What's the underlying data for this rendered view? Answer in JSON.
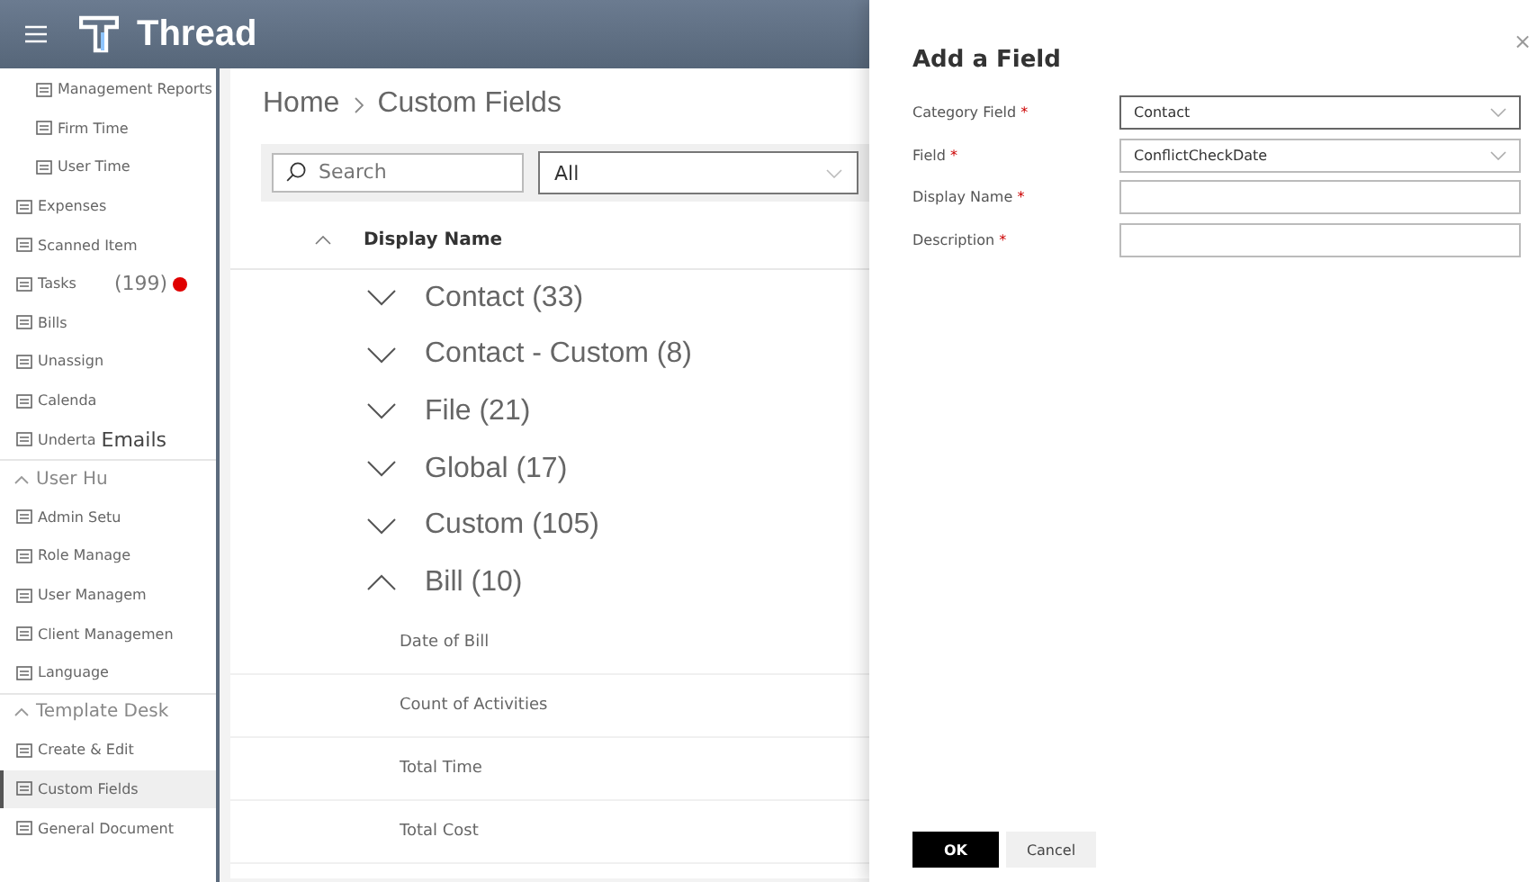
{
  "header": {
    "title": "Thread"
  },
  "sidebar": {
    "items": [
      {
        "kind": "subitem",
        "label": "Management Reports",
        "selected": false
      },
      {
        "kind": "subitem",
        "label": "Firm Time",
        "selected": false
      },
      {
        "kind": "subitem",
        "label": "User Time",
        "selected": false
      },
      {
        "kind": "item",
        "label": "Expenses",
        "selected": false
      },
      {
        "kind": "item",
        "label": "Scanned Item",
        "selected": false
      },
      {
        "kind": "item",
        "label": "Tasks",
        "badge": "(199)",
        "selected": false
      },
      {
        "kind": "item",
        "label": "Bills",
        "selected": false
      },
      {
        "kind": "item",
        "label": "Unassign",
        "selected": false
      },
      {
        "kind": "item",
        "label": "Calenda",
        "selected": false
      },
      {
        "kind": "item",
        "label": "Underta",
        "overlay": "Emails",
        "selected": false
      },
      {
        "kind": "section",
        "label": "User Hu"
      },
      {
        "kind": "item",
        "label": "Admin Setu",
        "selected": false
      },
      {
        "kind": "item",
        "label": "Role Manage",
        "selected": false
      },
      {
        "kind": "item",
        "label": "User Managem",
        "selected": false
      },
      {
        "kind": "item",
        "label": "Client Managemen",
        "selected": false
      },
      {
        "kind": "item",
        "label": "Language",
        "selected": false
      },
      {
        "kind": "section",
        "label": "Template Desk"
      },
      {
        "kind": "item",
        "label": "Create & Edit",
        "selected": false
      },
      {
        "kind": "item",
        "label": "Custom Fields",
        "selected": true
      },
      {
        "kind": "item",
        "label": "General Document",
        "selected": false
      }
    ]
  },
  "main": {
    "breadcrumb": [
      "Home",
      "Custom Fields"
    ],
    "search": {
      "placeholder": "Search"
    },
    "filter": {
      "value": "All"
    },
    "column": "Display Name",
    "groups": [
      {
        "label": "Contact (33)",
        "expanded": false
      },
      {
        "label": "Contact - Custom (8)",
        "expanded": false
      },
      {
        "label": "File (21)",
        "expanded": false
      },
      {
        "label": "Global (17)",
        "expanded": false
      },
      {
        "label": "Custom (105)",
        "expanded": false
      },
      {
        "label": "Bill (10)",
        "expanded": true,
        "rows": [
          "Date of Bill",
          "Count of Activities",
          "Total Time",
          "Total Cost"
        ]
      }
    ]
  },
  "panel": {
    "title": "Add a Field",
    "close": "×",
    "fields": [
      {
        "kind": "dropdown",
        "label": "Category Field",
        "required_mark": "*",
        "value": "Contact"
      },
      {
        "kind": "dropdown",
        "label": "Field",
        "required_mark": "*",
        "value": "ConflictCheckDate"
      },
      {
        "kind": "text",
        "label": "Display Name",
        "required_mark": "*"
      },
      {
        "kind": "text",
        "label": "Description",
        "required_mark": "*"
      }
    ],
    "buttons": [
      {
        "kind": "primary",
        "label": "OK"
      },
      {
        "kind": "default",
        "label": "Cancel"
      }
    ]
  }
}
